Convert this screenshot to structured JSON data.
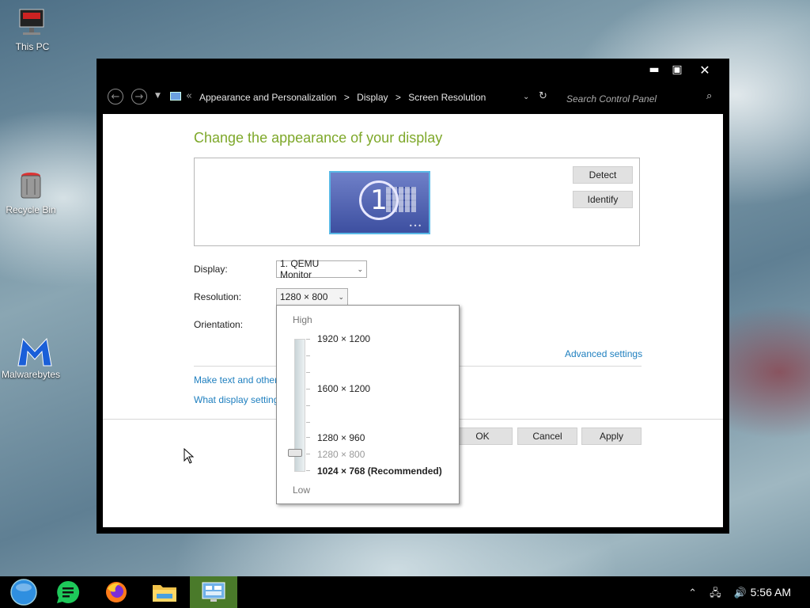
{
  "desktop": {
    "icons": [
      {
        "label": "This PC"
      },
      {
        "label": "Recycle Bin"
      },
      {
        "label": "Malwarebytes"
      }
    ]
  },
  "window": {
    "controls": {
      "minimize": "▬",
      "maximize": "▣",
      "close": "✕"
    },
    "nav": {
      "back": "←",
      "forward": "→",
      "recent": "▼",
      "sep": "«",
      "breadcrumb": [
        "Appearance and Personalization",
        ">",
        "Display",
        ">",
        "Screen Resolution"
      ],
      "address_dropdown": "⌄",
      "refresh": "↻",
      "search_placeholder": "Search Control Panel",
      "search_icon": "⌕"
    },
    "title": "Change the appearance of your display",
    "monitor_number": "1",
    "monitor_dots": "•••",
    "detect_label": "Detect",
    "identify_label": "Identify",
    "display_label": "Display:",
    "display_value": "1. QEMU Monitor",
    "resolution_label": "Resolution:",
    "resolution_value": "1280 × 800",
    "orientation_label": "Orientation:",
    "dropdown_arrow": "⌄",
    "advanced_link": "Advanced settings",
    "link_text_size": "Make text and other",
    "link_help": "What display setting",
    "ok_label": "OK",
    "cancel_label": "Cancel",
    "apply_label": "Apply"
  },
  "resolution_popup": {
    "high_label": "High",
    "low_label": "Low",
    "options": [
      {
        "label": "1920 × 1200"
      },
      {
        "label": "1600 × 1200"
      },
      {
        "label": "1280 × 960"
      },
      {
        "label": "1280 × 800",
        "state": "current"
      },
      {
        "label": "1024 × 768 (Recommended)",
        "state": "recommended"
      }
    ]
  },
  "taskbar": {
    "tray": {
      "chevron": "⌃",
      "network": "🖧",
      "volume": "🔊"
    },
    "clock": "5:56 AM"
  },
  "colors": {
    "title_green": "#7ea82a",
    "link_blue": "#1e7fbf",
    "active_task": "#4a7a2a"
  }
}
